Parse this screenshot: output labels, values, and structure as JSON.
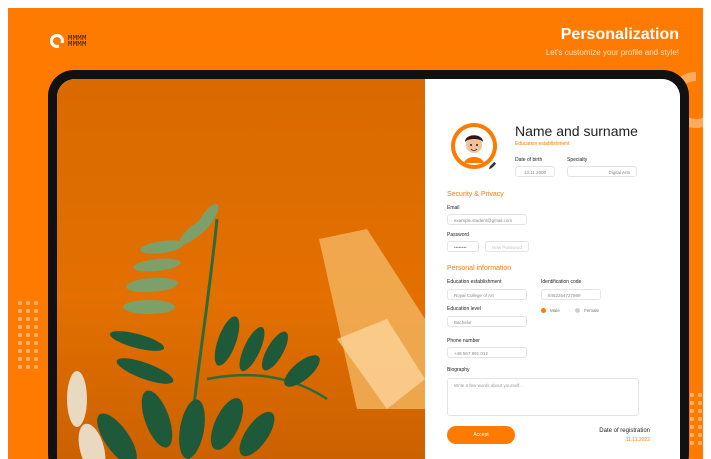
{
  "header": {
    "logo_text": "MMMM\nMMMM",
    "title": "Personalization",
    "subtitle": "Let's customize your profile and style!"
  },
  "profile": {
    "name": "Name and surname",
    "education_subtitle": "Education establishment",
    "date_of_birth_label": "Date of birth",
    "date_of_birth_value": "13.11.2000",
    "specialty_label": "Specialty",
    "specialty_value": "Digital Arts"
  },
  "security": {
    "section_title": "Security & Privacy",
    "email_label": "Email",
    "email_value": "example.student@gmail.com",
    "password_label": "Password",
    "password_value": "••••••••",
    "new_password_placeholder": "New Password"
  },
  "personal": {
    "section_title": "Personal information",
    "education_label": "Education establishment",
    "education_value": "Royal College of Art",
    "identification_label": "Identification code",
    "identification_value": "8452264727989",
    "gender_options": [
      "Male",
      "Female"
    ],
    "gender_selected": "Male",
    "level_label": "Education level",
    "level_value": "Bachelor",
    "phone_label": "Phone number",
    "phone_value": "+48 567 891 012",
    "biography_label": "Biography",
    "biography_placeholder": "Write a few words about yourself..."
  },
  "footer": {
    "accept_label": "Accept",
    "registration_label": "Date of registration",
    "registration_date": "11.11.2022"
  },
  "colors": {
    "accent": "#ff7a00",
    "accent_light": "#ffb066",
    "text_dark": "#222222"
  }
}
